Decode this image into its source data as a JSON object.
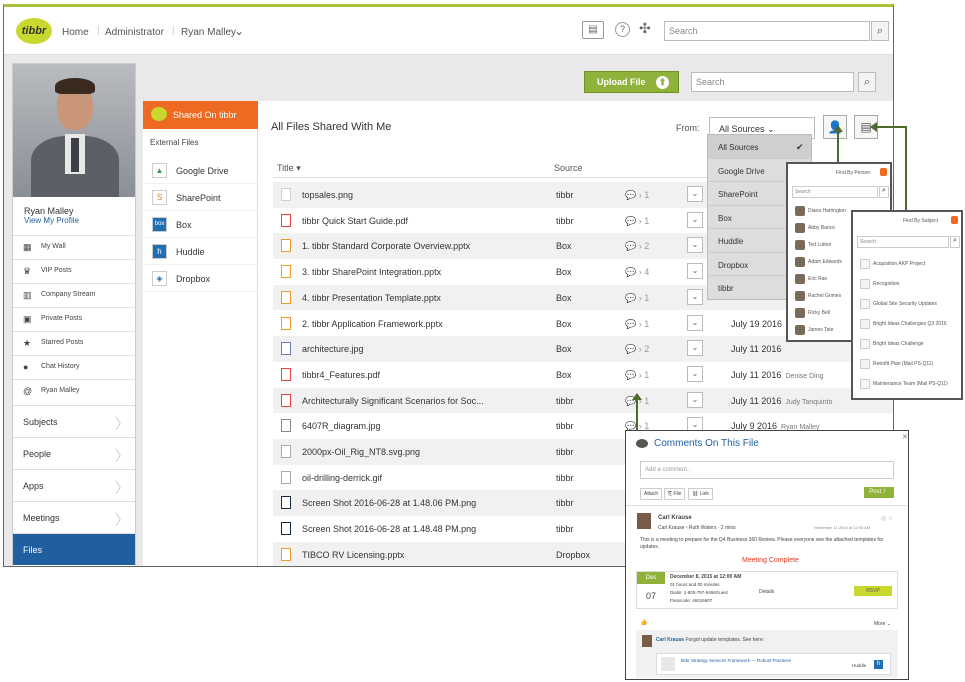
{
  "header": {
    "logo": "tibbr",
    "nav": [
      "Home",
      "Administrator",
      "Ryan Malley"
    ],
    "search_placeholder": "Search"
  },
  "profile": {
    "name": "Ryan Malley",
    "link": "View My Profile"
  },
  "left_menu": [
    "My Wall",
    "VIP Posts",
    "Company Stream",
    "Private Posts",
    "Starred Posts",
    "Chat History",
    "Ryan Malley"
  ],
  "sections": [
    "Subjects",
    "People",
    "Apps",
    "Meetings",
    "Files"
  ],
  "upload": {
    "label": "Upload File",
    "search_placeholder": "Search"
  },
  "sources": {
    "active": "Shared On tibbr",
    "external_label": "External Files",
    "items": [
      "Google Drive",
      "SharePoint",
      "Box",
      "Huddle",
      "Dropbox"
    ]
  },
  "main": {
    "title": "All Files Shared With Me",
    "from_label": "From:",
    "from_value": "All Sources",
    "col_title": "Title",
    "col_source": "Source"
  },
  "files": [
    {
      "name": "topsales.png",
      "source": "tibbr",
      "count": "1",
      "date": "",
      "by": ""
    },
    {
      "name": "tibbr Quick Start Guide.pdf",
      "source": "tibbr",
      "count": "1",
      "date": "",
      "by": ""
    },
    {
      "name": "1. tibbr Standard Corporate Overview.pptx",
      "source": "Box",
      "count": "2",
      "date": "",
      "by": ""
    },
    {
      "name": "3. tibbr SharePoint Integration.pptx",
      "source": "Box",
      "count": "4",
      "date": "",
      "by": ""
    },
    {
      "name": "4. tibbr Presentation Template.pptx",
      "source": "Box",
      "count": "1",
      "date": "",
      "by": ""
    },
    {
      "name": "2. tibbr Application Framework.pptx",
      "source": "Box",
      "count": "1",
      "date": "July 19 2016",
      "by": ""
    },
    {
      "name": "architecture.jpg",
      "source": "Box",
      "count": "2",
      "date": "July 11 2016",
      "by": ""
    },
    {
      "name": "tibbr4_Features.pdf",
      "source": "Box",
      "count": "1",
      "date": "July 11 2016",
      "by": "Denise Ding"
    },
    {
      "name": "Architecturally Significant Scenarios for Soc...",
      "source": "tibbr",
      "count": "1",
      "date": "July 11 2016",
      "by": "Judy Tanquinto"
    },
    {
      "name": "6407R_diagram.jpg",
      "source": "tibbr",
      "count": "1",
      "date": "July 9 2016",
      "by": "Ryan Malley"
    },
    {
      "name": "2000px-Oil_Rig_NT8.svg.png",
      "source": "tibbr",
      "count": "",
      "date": "",
      "by": ""
    },
    {
      "name": "oil-drilling-derrick.gif",
      "source": "tibbr",
      "count": "",
      "date": "",
      "by": ""
    },
    {
      "name": "Screen Shot 2016-06-28 at 1.48.06 PM.png",
      "source": "tibbr",
      "count": "",
      "date": "",
      "by": ""
    },
    {
      "name": "Screen Shot 2016-06-28 at 1.48.48 PM.png",
      "source": "tibbr",
      "count": "",
      "date": "",
      "by": ""
    },
    {
      "name": "TIBCO RV Licensing.pptx",
      "source": "Dropbox",
      "count": "",
      "date": "",
      "by": ""
    }
  ],
  "dropdown": [
    "All Sources",
    "Google Drive",
    "SharePoint",
    "Box",
    "Huddle",
    "Dropbox",
    "tibbr"
  ],
  "find_person": {
    "title": "Find By Person",
    "search": "Search",
    "people": [
      "Diana Harrington",
      "Abby Banco",
      "Ted Lutton",
      "Adam Edwards",
      "Eric Rae",
      "Rachel Grimes",
      "Ricky Bell",
      "James Tate"
    ]
  },
  "find_subject": {
    "title": "Find By Subject",
    "search": "Search",
    "subjects": [
      "Acquisition AKP Project",
      "Recognition",
      "Global Site Security Updates",
      "Bright Ideas Challenges Q3 2016",
      "Bright Ideas Challenge",
      "Retrofit Plan (Mail PS-Q11)",
      "Maintenance Team (Mail PS-Q11)"
    ]
  },
  "comments": {
    "title": "Comments On This File",
    "placeholder": "Add a comment..",
    "attach": "Attach",
    "file": "File",
    "link": "Link",
    "post": "Post",
    "author": "Carl Krause",
    "author_sub": "Carl Krause",
    "to": "Ruth Waters",
    "ago": "2 mins",
    "stamp": "November 11 2016 at 12:00 AM",
    "body": "This is a meeting to prepare for the Q4 Business 360 Review. Please everyone see the attached templates for updates.",
    "status": "Meeting Complete",
    "cal_month": "Dec",
    "cal_day": "07",
    "meet_time": "December 8, 2015 at 12:00 AM",
    "meet_dur": "01 hours and 00 minutes",
    "dial": "Dialin: 1-800-797-9466Guest",
    "passcode": "Passcode: 46016607",
    "details": "Details",
    "rsvp": "RSVP",
    "more": "More",
    "reply_author": "Carl Krause",
    "reply_text": "Forgot update templates. See here:",
    "attachment": "tibbr Strategy Services Framework — Robust Practices",
    "att_src": "Huddle"
  }
}
